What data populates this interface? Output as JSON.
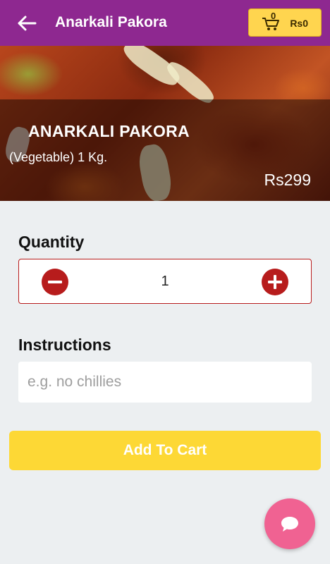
{
  "appbar": {
    "title": "Anarkali Pakora",
    "cart": {
      "count": "0",
      "amount": "Rs0"
    }
  },
  "product": {
    "name": "ANARKALI PAKORA",
    "description": "(Vegetable) 1 Kg.",
    "price": "Rs299"
  },
  "quantity": {
    "label": "Quantity",
    "value": "1"
  },
  "instructions": {
    "label": "Instructions",
    "placeholder": "e.g. no chillies"
  },
  "add_to_cart_label": "Add To Cart",
  "colors": {
    "appbar": "#8e2890",
    "cart_button": "#ffd54f",
    "quantity_accent": "#b71c1c",
    "add_to_cart": "#fdd835",
    "fab": "#f06292"
  },
  "icons": {
    "back": "arrow-left-icon",
    "cart": "shopping-cart-icon",
    "minus": "minus-circle-icon",
    "plus": "plus-circle-icon",
    "chat": "chat-bubble-icon"
  }
}
